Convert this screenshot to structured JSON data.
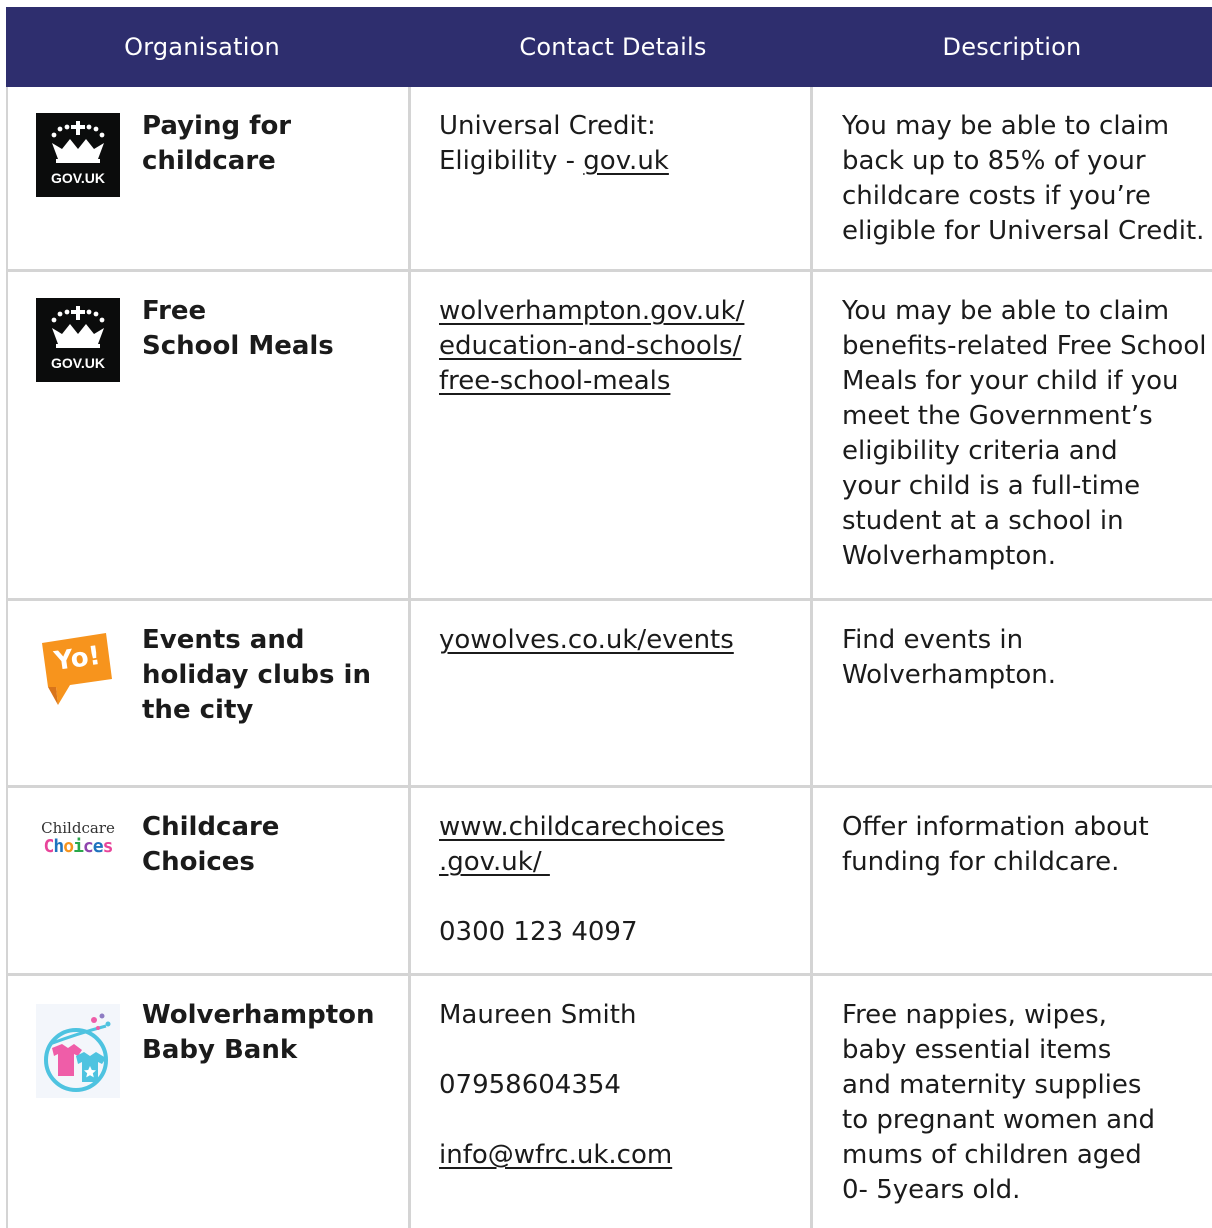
{
  "header": {
    "organisation": "Organisation",
    "contact_details": "Contact Details",
    "description": "Description"
  },
  "colors": {
    "header_bg": "#2e2e6e",
    "header_text": "#ffffff",
    "grid": "#d4d4d4",
    "yo_orange": "#f7941d",
    "baby_pink": "#ef5da8",
    "baby_blue": "#4ec3e0"
  },
  "rows": [
    {
      "logo": {
        "icon": "gov-uk-crown-icon",
        "text": "GOV.UK"
      },
      "organisation": [
        "Paying for",
        "childcare"
      ],
      "contact": {
        "line1": "Universal Credit:",
        "line2_prefix": "Eligibility - ",
        "line2_link": "gov.uk"
      },
      "description": [
        "You may be able to claim",
        "back up to 85% of your",
        "childcare costs if you’re",
        "eligible for Universal Credit."
      ]
    },
    {
      "logo": {
        "icon": "gov-uk-crown-icon",
        "text": "GOV.UK"
      },
      "organisation": [
        "Free",
        "School Meals"
      ],
      "contact": {
        "links": [
          "wolverhampton.gov.uk/",
          "education-and-schools/",
          "free-school-meals"
        ]
      },
      "description": [
        "You may be able to claim",
        "benefits-related Free School",
        "Meals for your child if you",
        "meet the Government’s",
        "eligibility criteria and",
        "your child is a full-time",
        "student at a school in",
        "Wolverhampton."
      ]
    },
    {
      "logo": {
        "icon": "yo-wolves-logo-icon",
        "text": "Yo!"
      },
      "organisation": [
        "Events and",
        "holiday clubs in",
        "the city"
      ],
      "contact": {
        "link": "yowolves.co.uk/events"
      },
      "description": [
        "Find events in",
        "Wolverhampton."
      ]
    },
    {
      "logo": {
        "icon": "childcare-choices-logo-icon",
        "text_top": "Childcare",
        "text_bottom": "Choices"
      },
      "organisation": [
        "Childcare",
        "Choices"
      ],
      "contact": {
        "links": [
          "www.childcarechoices",
          ".gov.uk/ "
        ],
        "phone": "0300 123 4097"
      },
      "description": [
        "Offer information about",
        "funding for childcare."
      ]
    },
    {
      "logo": {
        "icon": "baby-bank-logo-icon"
      },
      "organisation": [
        "Wolverhampton",
        "Baby Bank"
      ],
      "contact": {
        "name": "Maureen Smith",
        "phone": "07958604354",
        "email": "info@wfrc.uk.com"
      },
      "description": [
        "Free nappies, wipes,",
        "baby essential items",
        "and maternity supplies",
        "to pregnant women and",
        "mums of children aged",
        "0- 5years old."
      ]
    }
  ]
}
